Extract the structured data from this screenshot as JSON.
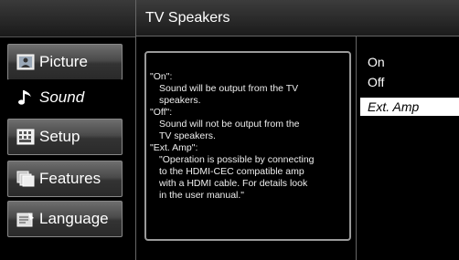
{
  "header": {
    "title": "TV Speakers"
  },
  "menu": {
    "items": [
      {
        "label": "Picture",
        "icon": "picture-icon"
      },
      {
        "label": "Sound",
        "icon": "music-note-icon"
      },
      {
        "label": "Setup",
        "icon": "keyboard-icon"
      },
      {
        "label": "Features",
        "icon": "features-icon"
      },
      {
        "label": "Language",
        "icon": "language-icon"
      }
    ],
    "selected": "Sound"
  },
  "description": {
    "lines": [
      "\"On\":",
      "Sound will be output from the TV",
      "speakers.",
      "\"Off\":",
      "Sound will not be output from the",
      "TV speakers.",
      "\"Ext. Amp\":",
      "\"Operation is possible by connecting",
      "to the HDMI-CEC compatible amp",
      "with a HDMI cable. For details look",
      "in the user manual.\""
    ]
  },
  "options": {
    "items": [
      "On",
      "Off",
      "Ext. Amp"
    ],
    "selected": "Ext. Amp"
  }
}
